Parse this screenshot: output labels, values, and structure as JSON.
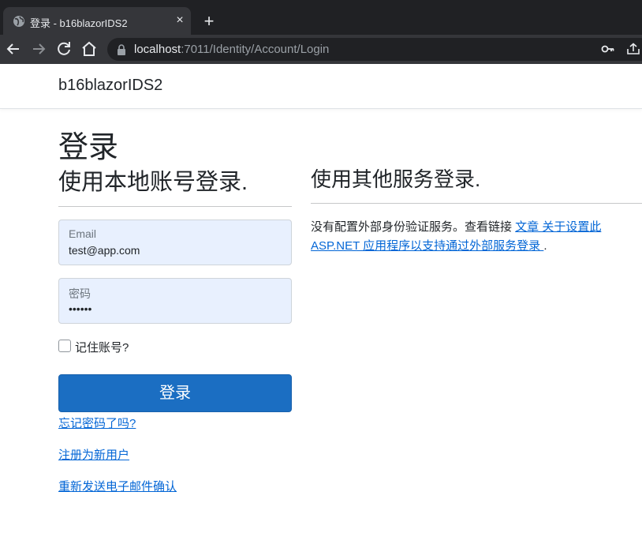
{
  "browser": {
    "tab_title": "登录 - b16blazorIDS2",
    "tab_close": "×",
    "new_tab": "+",
    "url_host": "localhost",
    "url_rest": ":7011/Identity/Account/Login",
    "icons": [
      "globe-icon",
      "back-icon",
      "forward-icon",
      "reload-icon",
      "home-icon",
      "lock-icon",
      "key-icon",
      "share-icon"
    ]
  },
  "navbar": {
    "brand": "b16blazorIDS2"
  },
  "page": {
    "title": "登录"
  },
  "local_login": {
    "heading": "使用本地账号登录.",
    "email": {
      "label": "Email",
      "value": "test@app.com"
    },
    "password": {
      "label": "密码",
      "value": "••••••"
    },
    "remember_label": "记住账号?",
    "remember_checked": false,
    "submit_label": "登录",
    "links": {
      "forgot": "忘记密码了吗?",
      "register": "注册为新用户",
      "resend": "重新发送电子邮件确认"
    }
  },
  "external_login": {
    "heading": "使用其他服务登录.",
    "text_before": "没有配置外部身份验证服务。查看链接 ",
    "link_text": "文章 关于设置此 ASP.NET 应用程序以支持通过外部服务登录 ",
    "text_after": "."
  },
  "colors": {
    "primary": "#1b6ec2",
    "link": "#0366d6",
    "autofill_bg": "#e8f0fe",
    "chrome_dark": "#202124",
    "chrome_toolbar": "#35363a"
  }
}
